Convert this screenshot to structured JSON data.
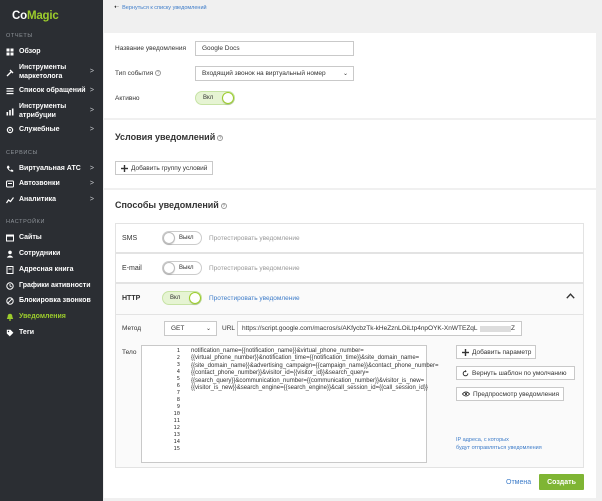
{
  "brand": {
    "logo_pre": "Co",
    "logo_post": "Magic",
    "accent": "#9ccc2c"
  },
  "sidebar": {
    "sections": [
      "ОТЧЕТЫ",
      "СЕРВИСЫ",
      "НАСТРОЙКИ"
    ],
    "items": [
      {
        "label": "Обзор",
        "icon": "overview-icon",
        "arrow": ""
      },
      {
        "label": "Инструменты маркетолога",
        "icon": "tools-icon",
        "arrow": ">"
      },
      {
        "label": "Список обращений",
        "icon": "list-icon",
        "arrow": ">"
      },
      {
        "label": "Инструменты атрибуции",
        "icon": "attribution-icon",
        "arrow": ">"
      },
      {
        "label": "Служебные",
        "icon": "service-icon",
        "arrow": ">"
      },
      {
        "label": "Виртуальная АТС",
        "icon": "phone-icon",
        "arrow": ">"
      },
      {
        "label": "Автозвонки",
        "icon": "autocall-icon",
        "arrow": ">"
      },
      {
        "label": "Аналитика",
        "icon": "analytics-icon",
        "arrow": ">"
      },
      {
        "label": "Сайты",
        "icon": "sites-icon",
        "arrow": ""
      },
      {
        "label": "Сотрудники",
        "icon": "employees-icon",
        "arrow": ""
      },
      {
        "label": "Адресная книга",
        "icon": "addressbook-icon",
        "arrow": ""
      },
      {
        "label": "Графики активности",
        "icon": "schedule-icon",
        "arrow": ""
      },
      {
        "label": "Блокировка звонков",
        "icon": "block-icon",
        "arrow": ""
      },
      {
        "label": "Уведомления",
        "icon": "bell-icon",
        "arrow": ""
      },
      {
        "label": "Теги",
        "icon": "tag-icon",
        "arrow": ""
      }
    ]
  },
  "back_link": "Вернуться к списку уведомлений",
  "form": {
    "name_label": "Название уведомления",
    "name_value": "Google Docs",
    "event_label": "Тип события",
    "event_value": "Входящий звонок на виртуальный номер",
    "active_label": "Активно",
    "active_toggle": "Вкл"
  },
  "conditions": {
    "title": "Условия уведомлений",
    "add_group": "Добавить группу условий"
  },
  "methods": {
    "title": "Способы уведомлений",
    "test_label": "Протестировать уведомление",
    "sms": {
      "name": "SMS",
      "toggle": "Выкл"
    },
    "email": {
      "name": "E-mail",
      "toggle": "Выкл"
    },
    "http": {
      "name": "HTTP",
      "toggle": "Вкл"
    }
  },
  "http": {
    "method_label": "Метод",
    "method_value": "GET",
    "url_label": "URL",
    "url_value": "https://script.google.com/macros/s/AKfycbzTk-kHeZznLOiLtp4npOYK-XnWTEZqL",
    "url_tail": "Z",
    "body_label": "Тело",
    "line_numbers": [
      "1",
      "2",
      "3",
      "4",
      "5",
      "6",
      "7",
      "8",
      "9",
      "10",
      "11",
      "12",
      "13",
      "14",
      "15"
    ],
    "body_text": "notification_name={{notification_name}}&virtual_phone_number=\n{{virtual_phone_number}}&notification_time={{notification_time}}&site_domain_name=\n{{site_domain_name}}&advertising_campaign={{campaign_name}}&contact_phone_number=\n{{contact_phone_number}}&visitor_id={{visitor_id}}&search_query=\n{{search_query}}&communication_number={{communication_number}}&visitor_is_new=\n{{visitor_is_new}}&search_engine={{search_engine}}&call_session_id={{call_session_id}}",
    "add_param": "Добавить параметр",
    "reset_template": "Вернуть шаблон по умолчанию",
    "preview": "Предпросмотр уведомления",
    "ip_link_1": "IP адреса, с которых",
    "ip_link_2": "будут отправляться уведомления"
  },
  "footer": {
    "cancel": "Отмена",
    "create": "Создать"
  }
}
